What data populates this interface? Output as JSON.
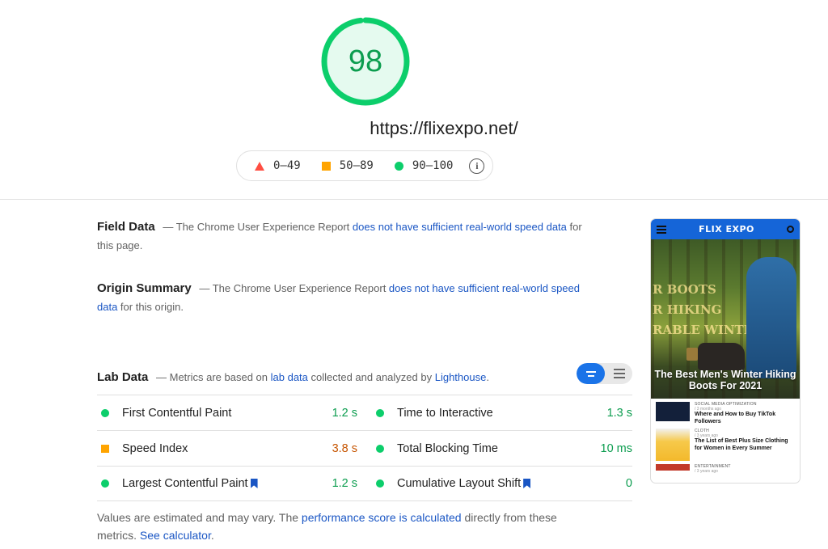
{
  "score": {
    "value": "98",
    "fraction": 0.98,
    "color": "#0cce6b",
    "bg_color": "#e5faef",
    "text_color": "#0c9d4f"
  },
  "url": "https://flixexpo.net/",
  "legend": {
    "fail": "0–49",
    "average": "50–89",
    "pass": "90–100",
    "info_icon": "info-icon"
  },
  "field_data": {
    "title": "Field Data",
    "dash": "—",
    "text_before": "The Chrome User Experience Report ",
    "link": "does not have sufficient real-world speed data",
    "text_after": " for this page."
  },
  "origin_summary": {
    "title": "Origin Summary",
    "dash": "—",
    "text_before": "The Chrome User Experience Report ",
    "link": "does not have sufficient real-world speed data",
    "text_after": " for this origin."
  },
  "lab_data": {
    "title": "Lab Data",
    "dash": "—",
    "text_before": "Metrics are based on ",
    "link1": "lab data",
    "text_middle": " collected and analyzed by ",
    "link2": "Lighthouse",
    "text_after": "."
  },
  "metrics": [
    [
      {
        "label": "First Contentful Paint",
        "value": "1.2 s",
        "status": "good",
        "bookmark": false
      },
      {
        "label": "Time to Interactive",
        "value": "1.3 s",
        "status": "good",
        "bookmark": false
      }
    ],
    [
      {
        "label": "Speed Index",
        "value": "3.8 s",
        "status": "avg",
        "bookmark": false
      },
      {
        "label": "Total Blocking Time",
        "value": "10 ms",
        "status": "good",
        "bookmark": false
      }
    ],
    [
      {
        "label": "Largest Contentful Paint",
        "value": "1.2 s",
        "status": "good",
        "bookmark": true
      },
      {
        "label": "Cumulative Layout Shift",
        "value": "0",
        "status": "good",
        "bookmark": true
      }
    ]
  ],
  "footnote": {
    "text_before": "Values are estimated and may vary. The ",
    "link1": "performance score is calculated",
    "text_middle": " directly from these metrics. ",
    "link2": "See calculator",
    "text_after": "."
  },
  "phone": {
    "logo": "FLIX EXPO",
    "ghost_text": "R BOOTS\nR HIKING\nRABLE WINTER",
    "hero_caption": "The Best Men's Winter Hiking Boots For 2021",
    "items": [
      {
        "category": "SOCIAL MEDIA OPTIMIZATION",
        "meta": "/ 3 months ago",
        "title": "Where and How to Buy TikTok Followers",
        "thumb": "dark"
      },
      {
        "category": "CLOTH",
        "meta": "/ 3 years ago",
        "title": "The List of Best Plus Size Clothing for Women in Every Summer",
        "thumb": "yellow"
      },
      {
        "category": "ENTERTAINMENT",
        "meta": "/ 3 years ago",
        "title": "",
        "thumb": "red"
      }
    ]
  }
}
